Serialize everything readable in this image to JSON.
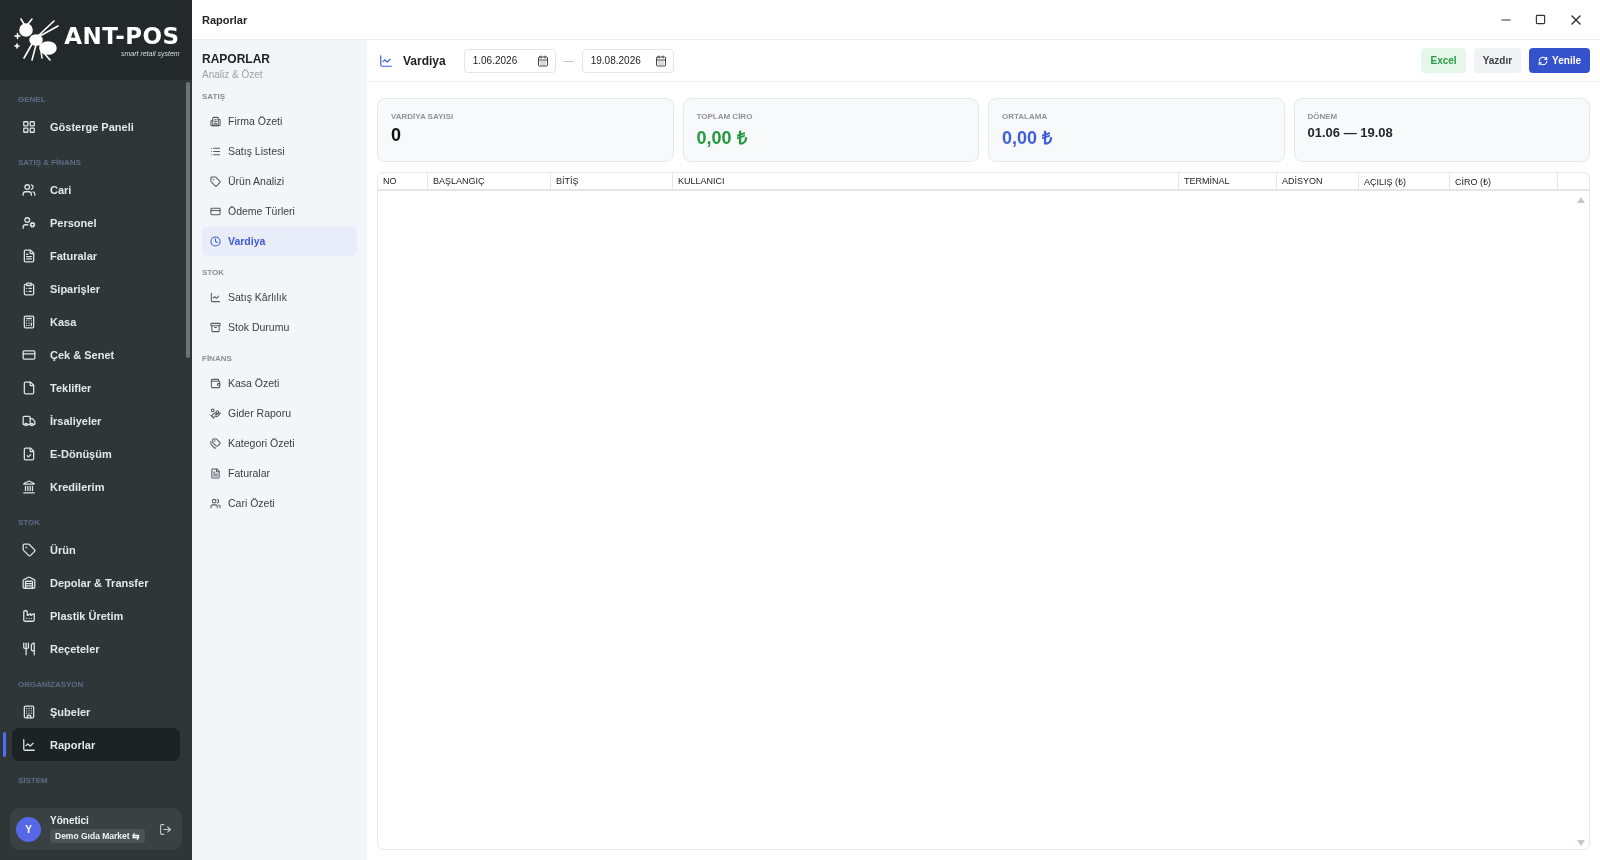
{
  "window": {
    "title": "Raporlar"
  },
  "sidebar": {
    "logo": {
      "name": "ANT-POS",
      "tagline": "smart retail system"
    },
    "sections": [
      {
        "label": "GENEL",
        "items": [
          {
            "label": "Gösterge Paneli",
            "selected": false
          }
        ]
      },
      {
        "label": "SATIŞ & FİNANS",
        "items": [
          {
            "label": "Cari",
            "selected": false
          },
          {
            "label": "Personel",
            "selected": false
          },
          {
            "label": "Faturalar",
            "selected": false
          },
          {
            "label": "Siparişler",
            "selected": false
          },
          {
            "label": "Kasa",
            "selected": false
          },
          {
            "label": "Çek & Senet",
            "selected": false
          },
          {
            "label": "Teklifler",
            "selected": false
          },
          {
            "label": "İrsaliyeler",
            "selected": false
          },
          {
            "label": "E-Dönüşüm",
            "selected": false
          },
          {
            "label": "Kredilerim",
            "selected": false
          }
        ]
      },
      {
        "label": "STOK",
        "items": [
          {
            "label": "Ürün",
            "selected": false
          },
          {
            "label": "Depolar & Transfer",
            "selected": false
          },
          {
            "label": "Plastik Üretim",
            "selected": false
          },
          {
            "label": "Reçeteler",
            "selected": false
          }
        ]
      },
      {
        "label": "ORGANİZASYON",
        "items": [
          {
            "label": "Şubeler",
            "selected": false
          },
          {
            "label": "Raporlar",
            "selected": true
          }
        ]
      },
      {
        "label": "SİSTEM"
      }
    ],
    "user": {
      "initial": "Y",
      "name": "Yönetici",
      "branch": "Demo Gıda Market",
      "switch_glyph": "⇆"
    }
  },
  "report_menu": {
    "title": "RAPORLAR",
    "subtitle": "Analiz & Özet",
    "sections": [
      {
        "label": "SATIŞ",
        "items": [
          {
            "label": "Firma Özeti",
            "selected": false
          },
          {
            "label": "Satış Listesi",
            "selected": false
          },
          {
            "label": "Ürün Analizi",
            "selected": false
          },
          {
            "label": "Ödeme Türleri",
            "selected": false
          },
          {
            "label": "Vardiya",
            "selected": true
          }
        ]
      },
      {
        "label": "STOK",
        "items": [
          {
            "label": "Satış Kârlılık",
            "selected": false
          },
          {
            "label": "Stok Durumu",
            "selected": false
          }
        ]
      },
      {
        "label": "FİNANS",
        "items": [
          {
            "label": "Kasa Özeti",
            "selected": false
          },
          {
            "label": "Gider Raporu",
            "selected": false
          },
          {
            "label": "Kategori Özeti",
            "selected": false
          },
          {
            "label": "Faturalar",
            "selected": false
          },
          {
            "label": "Cari Özeti",
            "selected": false
          }
        ]
      }
    ]
  },
  "toolbar": {
    "title": "Vardiya",
    "date_from": "1.06.2026",
    "separator": "—",
    "date_to": "19.08.2026",
    "buttons": [
      {
        "label": "Excel",
        "kind": "excel"
      },
      {
        "label": "Yazdır",
        "kind": "plain"
      },
      {
        "label": "Yenile",
        "kind": "primary"
      }
    ]
  },
  "stats": [
    {
      "label": "VARDİYA SAYISI",
      "value": "0",
      "kind": "count"
    },
    {
      "label": "TOPLAM CİRO",
      "value": "0,00 ₺",
      "kind": "positive"
    },
    {
      "label": "ORTALAMA",
      "value": "0,00 ₺",
      "kind": "accent"
    },
    {
      "label": "DÖNEM",
      "value": "01.06 — 19.08",
      "kind": "period"
    }
  ],
  "table": {
    "columns": [
      "NO",
      "BAŞLANGIÇ",
      "BİTİŞ",
      "KULLANICI",
      "TERMİNAL",
      "ADİSYON",
      "AÇILIŞ (₺)",
      "CİRO (₺)"
    ]
  }
}
